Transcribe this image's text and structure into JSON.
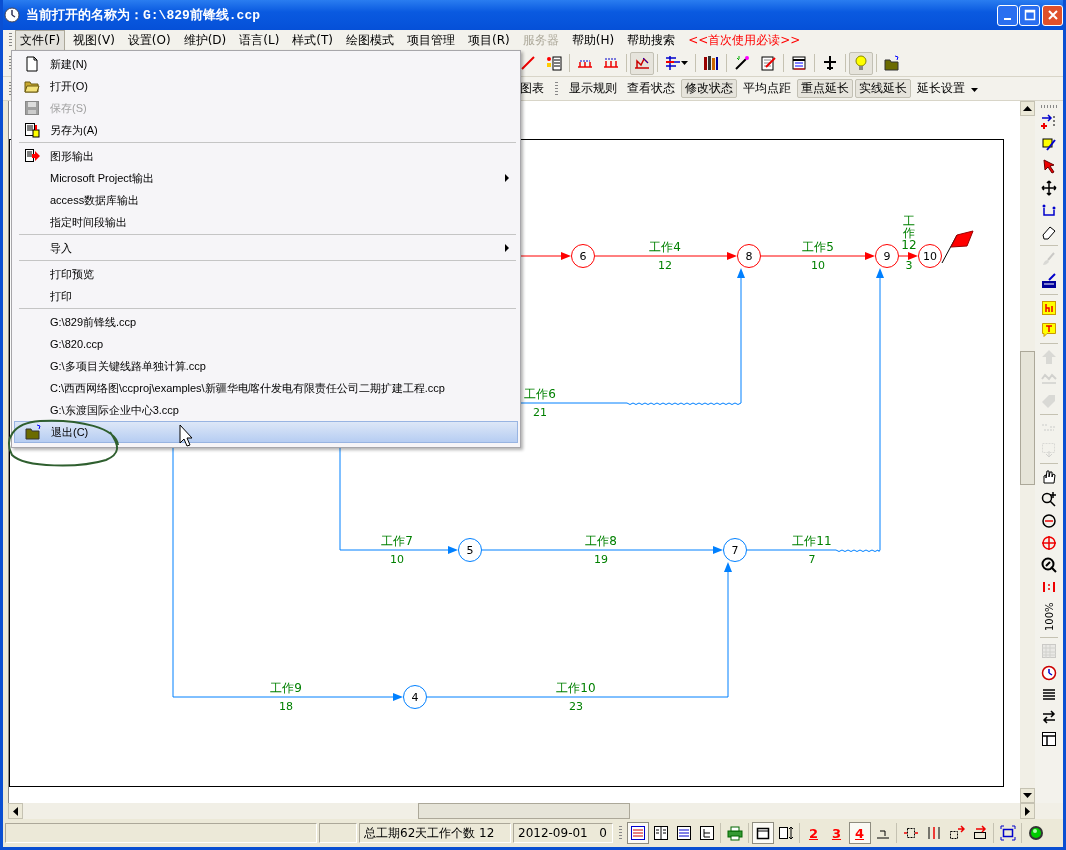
{
  "window": {
    "title": "当前打开的名称为：G:\\829前锋线.ccp"
  },
  "menu_bar": [
    {
      "label": "文件(F)",
      "selected": true,
      "disabled": false,
      "kind": "normal"
    },
    {
      "label": "视图(V)",
      "selected": false,
      "disabled": false,
      "kind": "normal"
    },
    {
      "label": "设置(O)",
      "selected": false,
      "disabled": false,
      "kind": "normal"
    },
    {
      "label": "维护(D)",
      "selected": false,
      "disabled": false,
      "kind": "normal"
    },
    {
      "label": "语言(L)",
      "selected": false,
      "disabled": false,
      "kind": "normal"
    },
    {
      "label": "样式(T)",
      "selected": false,
      "disabled": false,
      "kind": "normal"
    },
    {
      "label": "绘图模式",
      "selected": false,
      "disabled": false,
      "kind": "normal"
    },
    {
      "label": "项目管理",
      "selected": false,
      "disabled": false,
      "kind": "normal"
    },
    {
      "label": "项目(R)",
      "selected": false,
      "disabled": false,
      "kind": "normal"
    },
    {
      "label": "服务器",
      "selected": false,
      "disabled": true,
      "kind": "normal"
    },
    {
      "label": "帮助(H)",
      "selected": false,
      "disabled": false,
      "kind": "normal"
    },
    {
      "label": "帮助搜索",
      "selected": false,
      "disabled": false,
      "kind": "normal"
    },
    {
      "label": "<<首次使用必读>>",
      "selected": false,
      "disabled": false,
      "kind": "notice"
    }
  ],
  "toolbar": [
    {
      "pressed": false
    },
    {
      "pressed": false
    },
    {
      "pressed": false
    },
    {
      "pressed": false
    },
    {
      "pressed": true
    },
    {
      "pressed": false
    },
    {
      "pressed": false
    },
    {
      "pressed": false
    },
    {
      "pressed": false
    },
    {
      "pressed": false
    },
    {
      "pressed": false
    },
    {
      "pressed": true
    },
    {
      "pressed": false
    }
  ],
  "toolbar_2": [
    {
      "label": "图表",
      "pressed": false,
      "kind": "button"
    },
    {
      "label": "显示规则",
      "pressed": false,
      "kind": "button"
    },
    {
      "label": "查看状态",
      "pressed": false,
      "kind": "button"
    },
    {
      "label": "修改状态",
      "pressed": true,
      "kind": "button"
    },
    {
      "label": "平均点距",
      "pressed": false,
      "kind": "button"
    },
    {
      "label": "重点延长",
      "pressed": true,
      "kind": "button"
    },
    {
      "label": "实线延长",
      "pressed": true,
      "kind": "button"
    },
    {
      "label": "延长设置",
      "pressed": false,
      "kind": "dropdown"
    }
  ],
  "file_menu": [
    {
      "kind": "item",
      "label": "新建(N)",
      "disabled": false,
      "submenu": false,
      "selected": false
    },
    {
      "kind": "item",
      "label": "打开(O)",
      "disabled": false,
      "submenu": false,
      "selected": false
    },
    {
      "kind": "item",
      "label": "保存(S)",
      "disabled": true,
      "submenu": false,
      "selected": false
    },
    {
      "kind": "item",
      "label": "另存为(A)",
      "disabled": false,
      "submenu": false,
      "selected": false
    },
    {
      "kind": "separator"
    },
    {
      "kind": "item",
      "label": "图形输出",
      "disabled": false,
      "submenu": false,
      "selected": false
    },
    {
      "kind": "item",
      "label": "Microsoft Project输出",
      "disabled": false,
      "submenu": true,
      "selected": false
    },
    {
      "kind": "item",
      "label": "access数据库输出",
      "disabled": false,
      "submenu": false,
      "selected": false
    },
    {
      "kind": "item",
      "label": "指定时间段输出",
      "disabled": false,
      "submenu": false,
      "selected": false
    },
    {
      "kind": "separator"
    },
    {
      "kind": "item",
      "label": "导入",
      "disabled": false,
      "submenu": true,
      "selected": false
    },
    {
      "kind": "separator"
    },
    {
      "kind": "item",
      "label": "打印预览",
      "disabled": false,
      "submenu": false,
      "selected": false
    },
    {
      "kind": "item",
      "label": "打印",
      "disabled": false,
      "submenu": false,
      "selected": false
    },
    {
      "kind": "separator"
    },
    {
      "kind": "item",
      "label": "G:\\829前锋线.ccp",
      "disabled": false,
      "submenu": false,
      "selected": false
    },
    {
      "kind": "item",
      "label": "G:\\820.ccp",
      "disabled": false,
      "submenu": false,
      "selected": false
    },
    {
      "kind": "item",
      "label": "G:\\多项目关键线路单独计算.ccp",
      "disabled": false,
      "submenu": false,
      "selected": false
    },
    {
      "kind": "item",
      "label": "C:\\西西网络图\\ccproj\\examples\\新疆华电喀什发电有限责任公司二期扩建工程.ccp",
      "disabled": false,
      "submenu": false,
      "selected": false
    },
    {
      "kind": "item",
      "label": "G:\\东渡国际企业中心3.ccp",
      "disabled": false,
      "submenu": false,
      "selected": false
    },
    {
      "kind": "item",
      "label": "退出(C)",
      "disabled": false,
      "submenu": false,
      "selected": true
    }
  ],
  "diagram": {
    "nodes": [
      {
        "label": "6",
        "critical": true
      },
      {
        "label": "8",
        "critical": true
      },
      {
        "label": "9",
        "critical": true
      },
      {
        "label": "10",
        "critical": true
      },
      {
        "label": "5",
        "critical": false
      },
      {
        "label": "7",
        "critical": false
      },
      {
        "label": "4",
        "critical": false
      }
    ],
    "activities": [
      {
        "critical": true
      },
      {
        "name": "工作4",
        "duration": "12",
        "critical": true
      },
      {
        "name": "工作5",
        "duration": "10",
        "critical": true
      },
      {
        "name": "工作12",
        "duration": "3",
        "critical": true
      },
      {
        "name": "工作6",
        "duration": "21",
        "critical": false
      },
      {
        "name": "工作7",
        "duration": "10",
        "critical": false
      },
      {
        "name": "工作8",
        "duration": "19",
        "critical": false
      },
      {
        "name": "工作11",
        "duration": "7",
        "critical": false
      },
      {
        "name": "工作9",
        "duration": "18",
        "critical": false
      },
      {
        "name": "工作10",
        "duration": "23",
        "critical": false
      }
    ]
  },
  "side_toolbar": [
    {
      "disabled": false
    },
    {
      "disabled": false
    },
    {
      "disabled": false
    },
    {
      "disabled": false
    },
    {
      "disabled": false
    },
    {
      "disabled": false
    },
    {
      "disabled": true
    },
    {
      "disabled": false
    },
    {
      "disabled": false
    },
    {
      "disabled": false
    },
    {
      "disabled": true
    },
    {
      "disabled": true
    },
    {
      "disabled": true
    },
    {
      "disabled": true
    },
    {
      "disabled": true
    },
    {
      "disabled": false
    },
    {
      "disabled": false
    },
    {
      "disabled": false
    },
    {
      "disabled": false
    },
    {
      "disabled": false
    },
    {
      "disabled": false
    },
    {
      "label": "100%",
      "disabled": false
    },
    {
      "disabled": true
    },
    {
      "disabled": false
    },
    {
      "disabled": false
    },
    {
      "disabled": false
    },
    {
      "disabled": false
    }
  ],
  "status_bar": {
    "panes": [
      "总工期62天工作个数 12",
      "2012-09-01",
      "0"
    ],
    "buttons": [
      {
        "pressed": true
      },
      {
        "pressed": false
      },
      {
        "pressed": false
      },
      {
        "pressed": false
      },
      {
        "pressed": false
      },
      {
        "pressed": true
      },
      {
        "pressed": false
      },
      {
        "label": "2",
        "pressed": false
      },
      {
        "label": "3",
        "pressed": false
      },
      {
        "label": "4",
        "pressed": true
      },
      {
        "pressed": false
      },
      {
        "pressed": false
      },
      {
        "pressed": false
      },
      {
        "pressed": false
      },
      {
        "pressed": false
      },
      {
        "pressed": false
      },
      {
        "pressed": false
      }
    ]
  }
}
